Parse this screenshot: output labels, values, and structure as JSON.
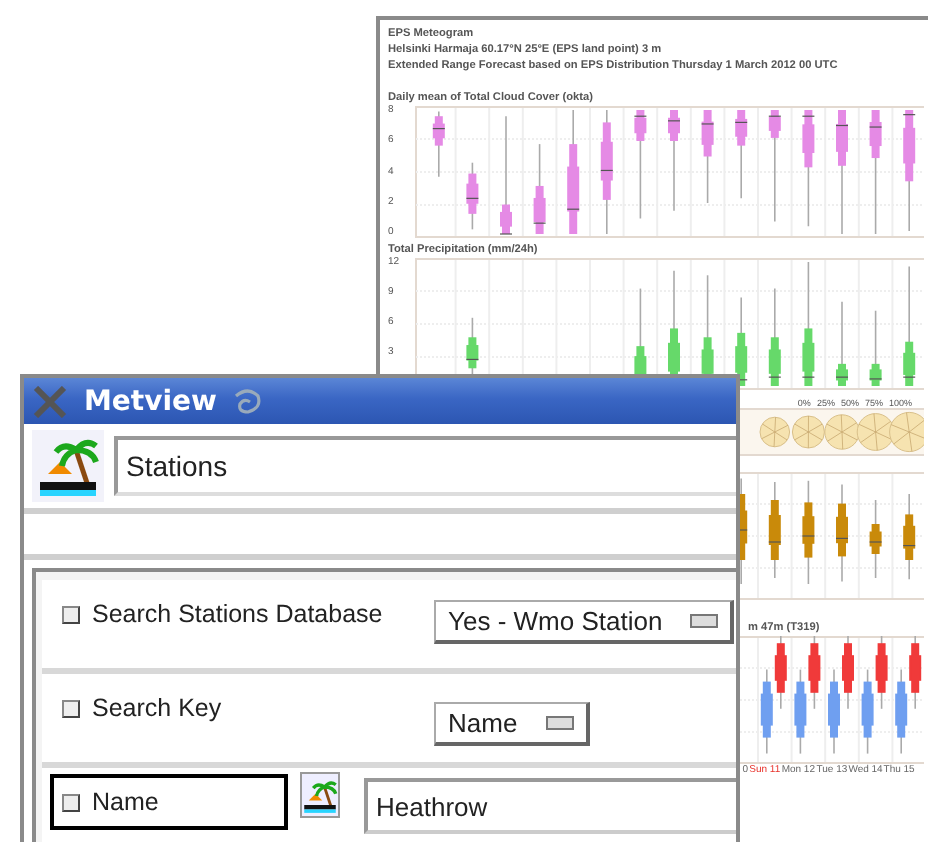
{
  "metrogram": {
    "title_lines": [
      "EPS Meteogram",
      "Helsinki Harmaja 60.17°N 25°E (EPS land point) 3 m",
      "Extended Range Forecast based on EPS Distribution Thursday  1 March 2012 00 UTC"
    ],
    "panels": [
      {
        "kind": "box",
        "title": "Daily mean of Total Cloud Cover (okta)",
        "yticks": [
          "8",
          "6",
          "4",
          "2",
          "0"
        ]
      },
      {
        "kind": "box",
        "title": "Total Precipitation (mm/24h)",
        "yticks": [
          "12",
          "9",
          "6",
          "3"
        ]
      },
      {
        "kind": "rose",
        "legend": [
          "0%",
          "25%",
          "50%",
          "75%",
          "100%"
        ]
      },
      {
        "kind": "box"
      },
      {
        "kind": "pair",
        "title": "m 47m (T319)"
      }
    ],
    "x_labels": [
      {
        "label": "0",
        "weekend": false
      },
      {
        "label": "Sun 11",
        "weekend": true
      },
      {
        "label": "Mon 12",
        "weekend": false
      },
      {
        "label": "Tue 13",
        "weekend": false
      },
      {
        "label": "Wed 14",
        "weekend": false
      },
      {
        "label": "Thu 15",
        "weekend": false
      }
    ]
  },
  "dialog": {
    "title": "Metview",
    "name_field": {
      "value": "Stations"
    },
    "params": [
      {
        "kind": "dropdown",
        "label": "Search Stations Database",
        "checked": false,
        "focused": false,
        "value": "Yes - Wmo Station"
      },
      {
        "kind": "dropdown",
        "label": "Search Key",
        "checked": false,
        "focused": false,
        "value": "Name"
      },
      {
        "kind": "text",
        "label": "Name",
        "checked": false,
        "focused": true,
        "value": "Heathrow"
      }
    ]
  }
}
